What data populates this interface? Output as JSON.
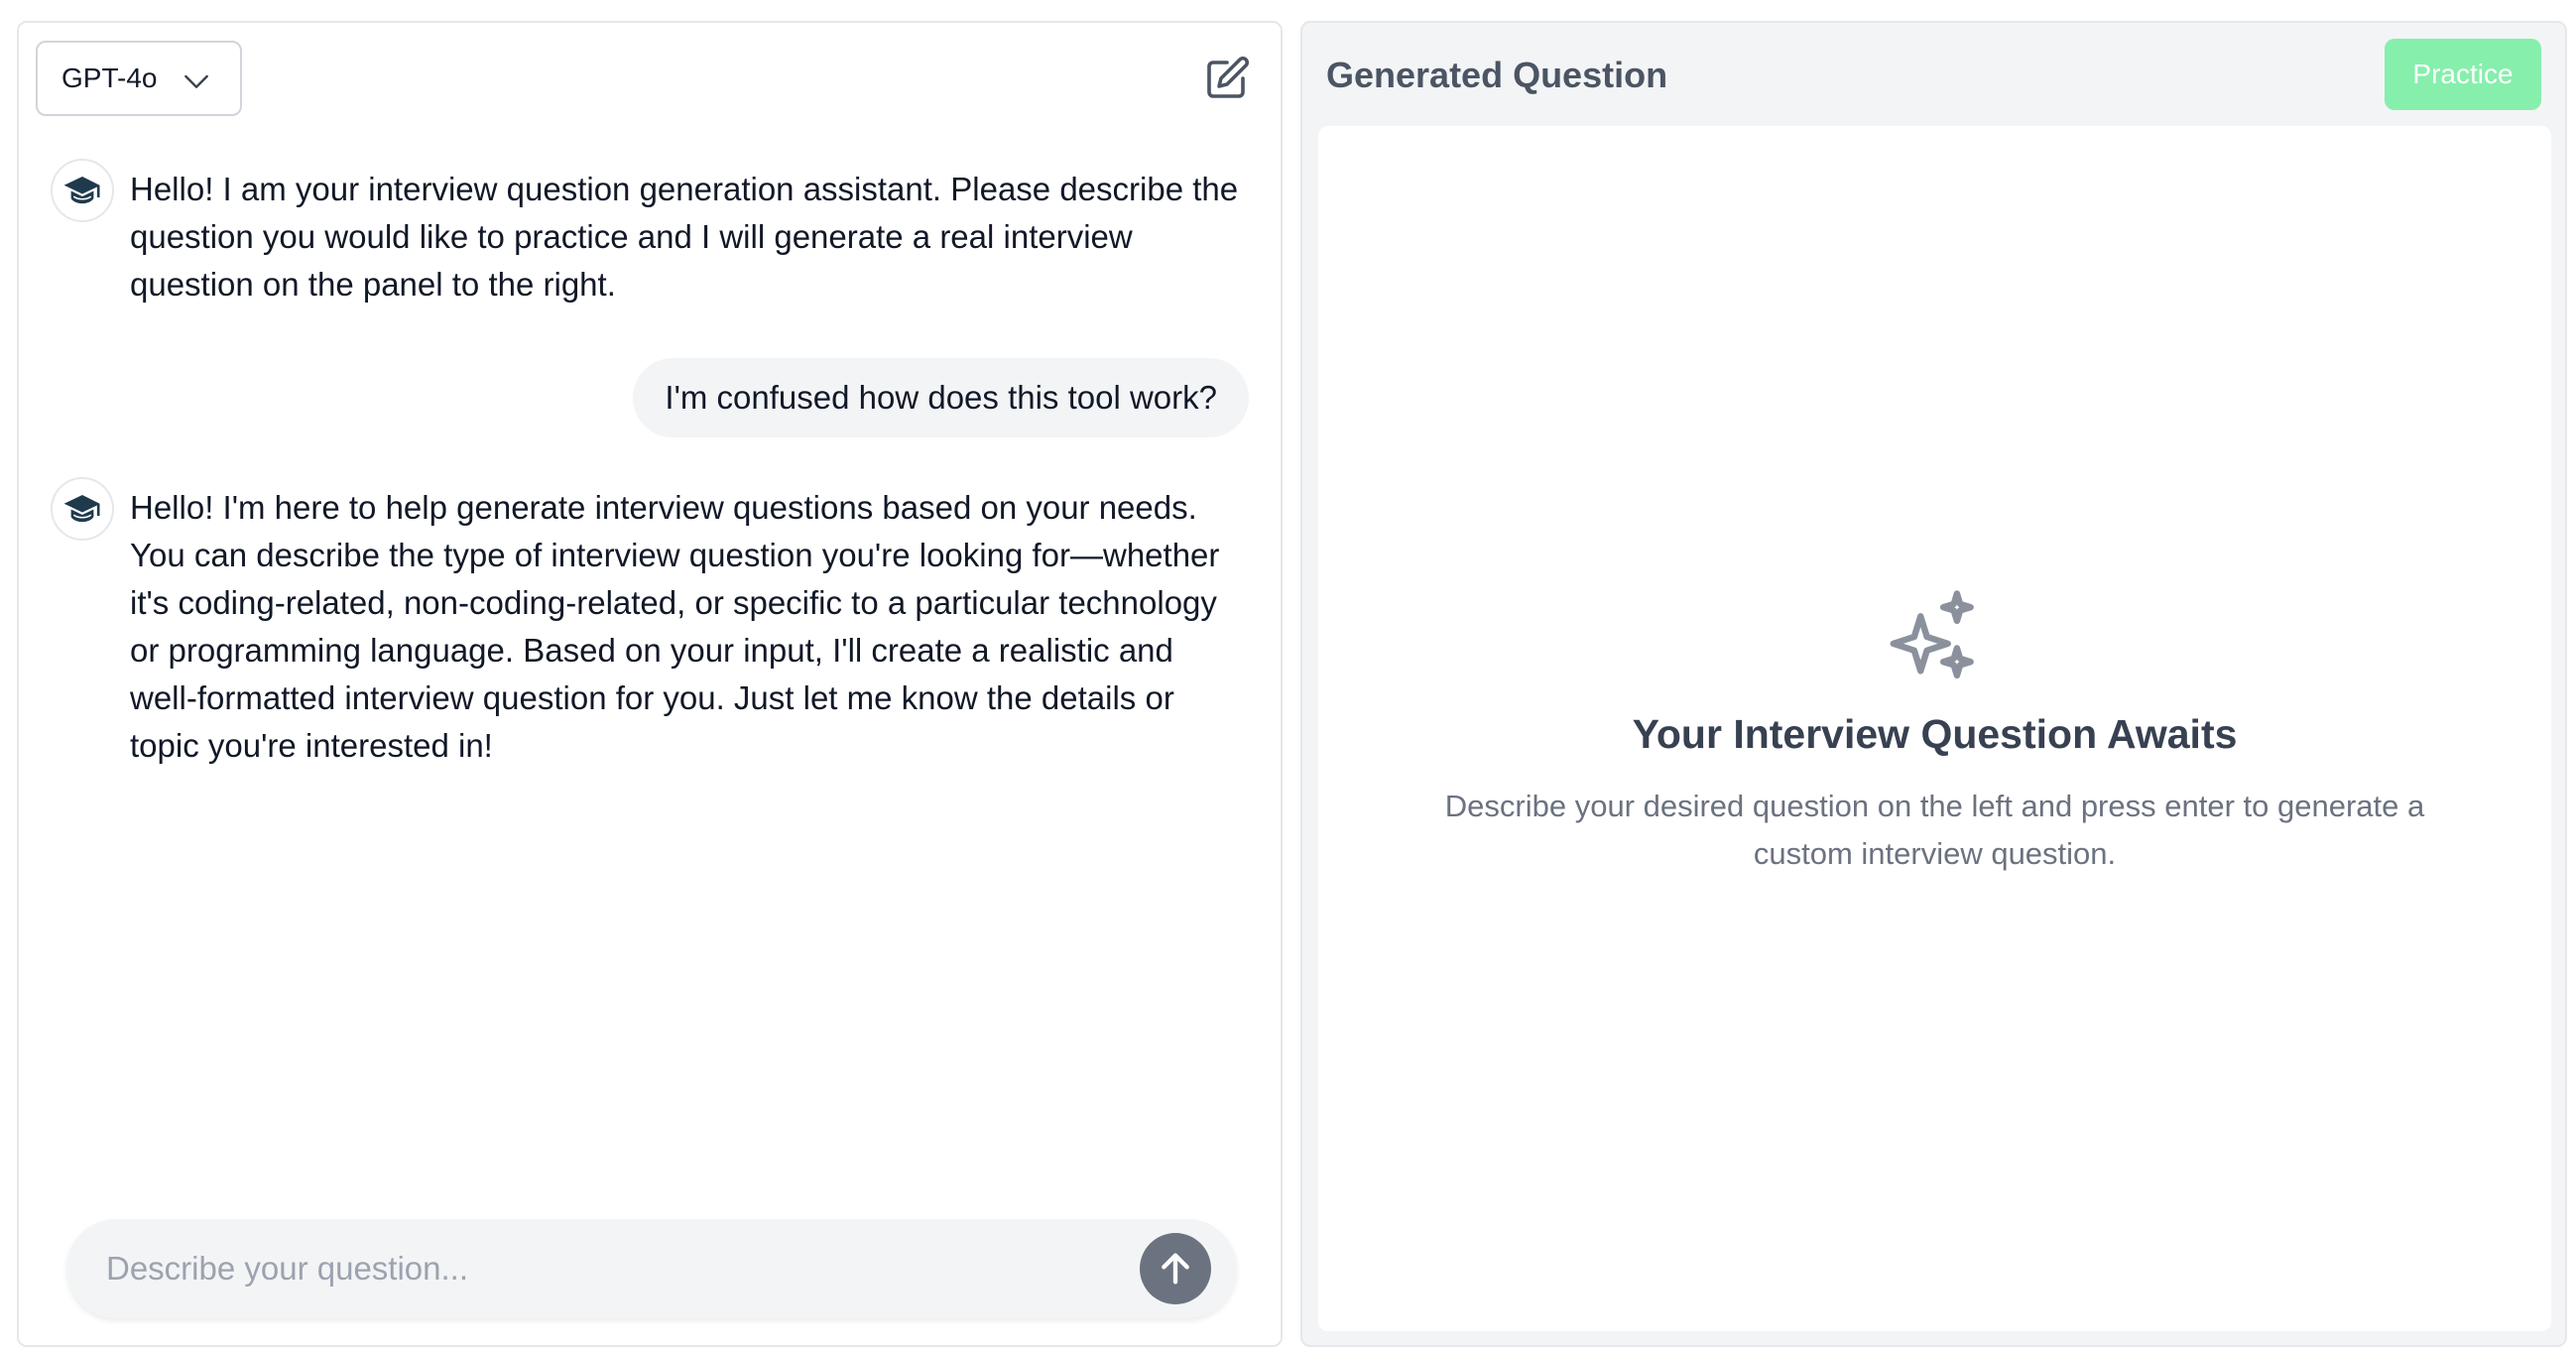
{
  "chat": {
    "model_label": "GPT-4o",
    "messages": {
      "bot1": "Hello! I am your interview question generation assistant. Please describe the question you would like to practice and I will generate a real interview question on the panel to the right.",
      "user1": "I'm confused how does this tool work?",
      "bot2": "Hello! I'm here to help generate interview questions based on your needs. You can describe the type of interview question you're looking for—whether it's coding-related, non-coding-related, or specific to a particular technology or programming language. Based on your input, I'll create a realistic and well-formatted interview question for you. Just let me know the details or topic you're interested in!"
    },
    "input_placeholder": "Describe your question...",
    "input_value": ""
  },
  "generated": {
    "title": "Generated Question",
    "practice_label": "Practice",
    "empty_title": "Your Interview Question Awaits",
    "empty_description": "Describe your desired question on the left and press enter to generate a custom interview question."
  },
  "colors": {
    "practice_button": "#86efac",
    "send_button": "#6b7280",
    "panel_bg": "#f3f4f6",
    "avatar_icon": "#1f3a4d"
  },
  "icons": {
    "model_dropdown": "chevron-down-icon",
    "new_chat": "edit-icon",
    "assistant_avatar": "graduation-cap-icon",
    "send": "arrow-up-icon",
    "empty_state": "sparkles-icon"
  }
}
